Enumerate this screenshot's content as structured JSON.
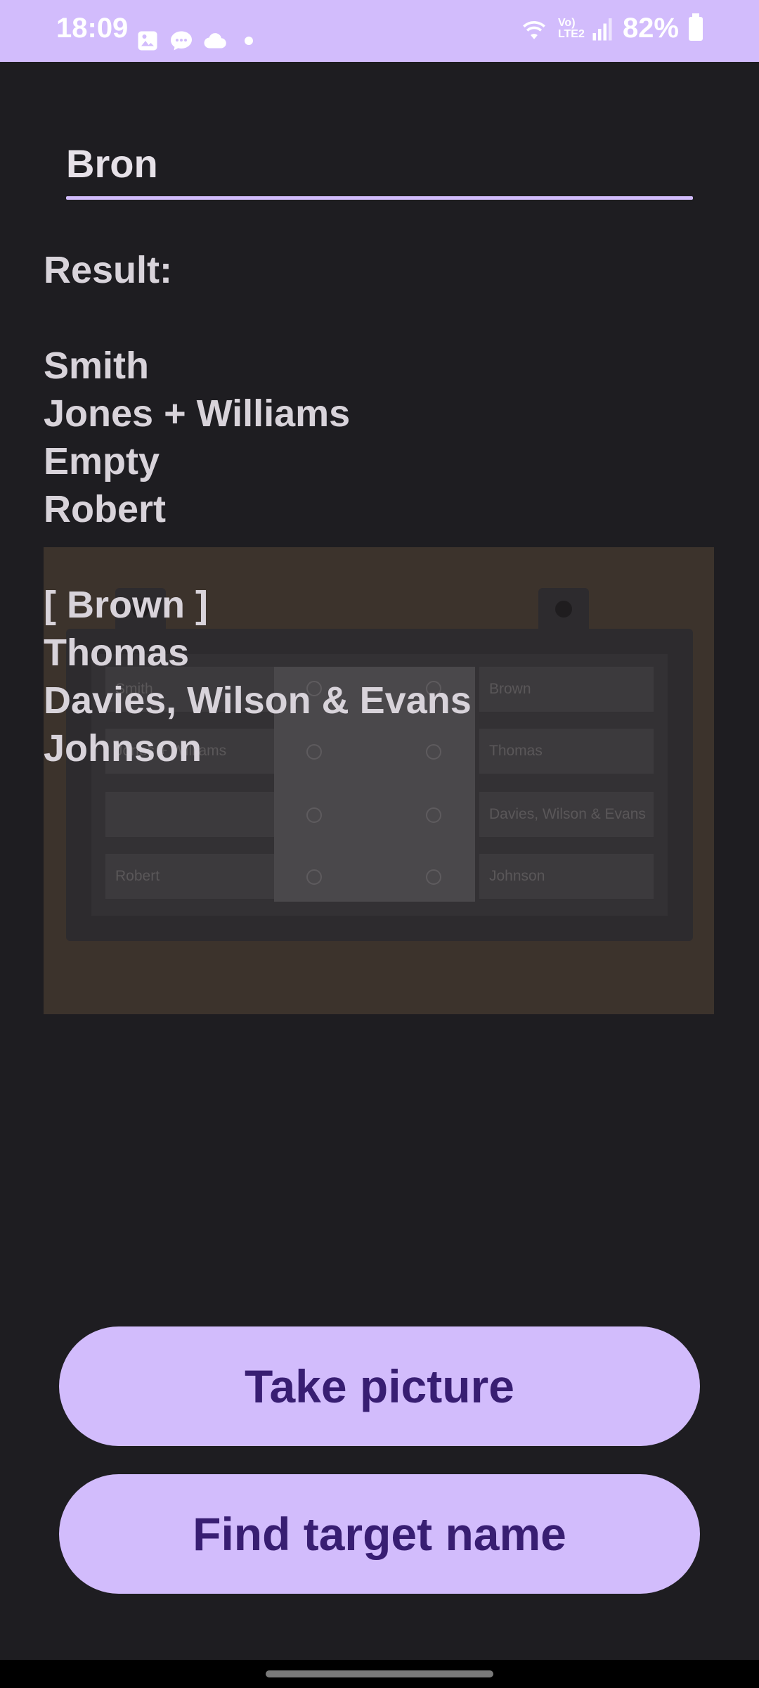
{
  "status_bar": {
    "time": "18:09",
    "battery": "82%",
    "network_label": "Vo) LTE2",
    "icons": [
      "image-icon",
      "chat-icon",
      "cloud-icon",
      "dot-icon",
      "wifi-icon",
      "signal-icon",
      "battery-icon"
    ]
  },
  "search": {
    "value": "Bron",
    "placeholder": ""
  },
  "result": {
    "heading": "Result:",
    "group1": [
      "Smith",
      "Jones + Williams",
      "Empty",
      "Robert"
    ],
    "group2": [
      "[ Brown ]",
      "Thomas",
      "Davies, Wilson & Evans",
      "Johnson"
    ]
  },
  "photo": {
    "left_slots": [
      "Smith",
      "Jones + Williams",
      "",
      "Robert"
    ],
    "right_slots": [
      "Brown",
      "Thomas",
      "Davies, Wilson & Evans",
      "Johnson"
    ]
  },
  "buttons": {
    "take_picture": "Take picture",
    "find_target": "Find target name"
  },
  "colors": {
    "accent": "#d2bcfc",
    "button_text": "#381e72",
    "background": "#1e1d21",
    "text": "#d8d3da"
  }
}
